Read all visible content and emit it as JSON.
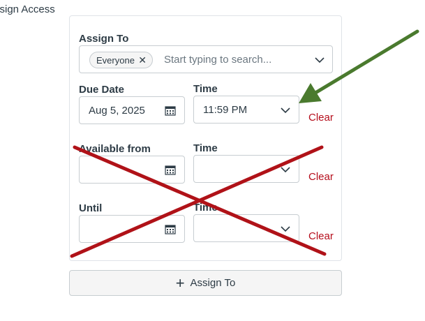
{
  "section": {
    "label": "ssign Access"
  },
  "assign_to": {
    "label": "Assign To",
    "chip": "Everyone",
    "chip_remove": "✕",
    "placeholder": "Start typing to search..."
  },
  "due": {
    "date_label": "Due Date",
    "date_value": "Aug 5, 2025",
    "time_label": "Time",
    "time_value": "11:59 PM",
    "clear": "Clear"
  },
  "available_from": {
    "date_label": "Available from",
    "date_value": "",
    "time_label": "Time",
    "time_value": "",
    "clear": "Clear"
  },
  "until": {
    "date_label": "Until",
    "date_value": "",
    "time_label": "Time",
    "time_value": "",
    "clear": "Clear"
  },
  "add_button": {
    "icon": "plus-icon",
    "label": "Assign To"
  },
  "annotations": {
    "arrow_color": "#4a7a2e",
    "cross_color": "#b01218"
  }
}
